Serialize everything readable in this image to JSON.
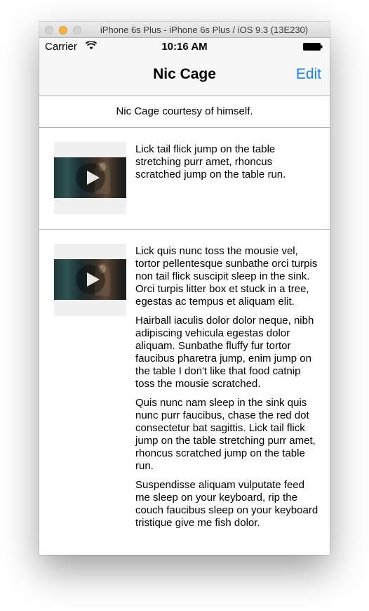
{
  "window": {
    "title": "iPhone 6s Plus - iPhone 6s Plus / iOS 9.3 (13E230)"
  },
  "status_bar": {
    "carrier": "Carrier",
    "time": "10:16 AM"
  },
  "nav": {
    "title": "Nic Cage",
    "edit_label": "Edit"
  },
  "caption": "Nic Cage courtesy of himself.",
  "rows": [
    {
      "paragraphs": [
        "Lick tail flick jump on the table stretching purr amet, rhoncus scratched jump on the table run."
      ]
    },
    {
      "paragraphs": [
        "Lick quis nunc toss the mousie vel, tortor pellentesque sunbathe orci turpis non tail flick suscipit sleep in the sink.  Orci turpis litter box et stuck in a tree, egestas ac tempus et aliquam elit.",
        "Hairball iaculis dolor dolor neque, nibh adipiscing vehicula egestas dolor aliquam.  Sunbathe fluffy fur tortor faucibus pharetra jump, enim jump on the table I don't like that food catnip toss the mousie scratched.",
        "Quis nunc nam sleep in the sink quis nunc purr faucibus, chase the red dot consectetur bat sagittis.  Lick tail flick jump on the table stretching purr amet, rhoncus scratched jump on the table run.",
        "Suspendisse aliquam vulputate feed me sleep on your keyboard, rip the couch faucibus sleep on your keyboard tristique give me fish dolor."
      ]
    }
  ],
  "colors": {
    "accent": "#1b7ff6",
    "separator": "#b2b2b2",
    "bar_bg": "#f7f7f7"
  }
}
